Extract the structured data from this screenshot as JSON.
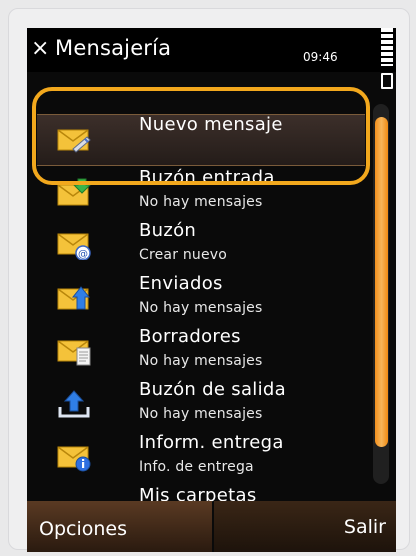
{
  "titlebar": {
    "close_glyph": "×",
    "title": "Mensajería",
    "clock": "09:46"
  },
  "items": [
    {
      "name": "Nuevo mensaje",
      "sub": "",
      "icon": "envelope-pen-icon"
    },
    {
      "name": "Buzón entrada",
      "sub": "No hay mensajes",
      "icon": "envelope-inbox-icon"
    },
    {
      "name": "Buzón",
      "sub": "Crear nuevo",
      "icon": "envelope-at-icon"
    },
    {
      "name": "Enviados",
      "sub": "No hay mensajes",
      "icon": "envelope-sent-icon"
    },
    {
      "name": "Borradores",
      "sub": "No hay mensajes",
      "icon": "envelope-draft-icon"
    },
    {
      "name": "Buzón de salida",
      "sub": "No hay mensajes",
      "icon": "outbox-upload-icon"
    },
    {
      "name": "Inform. entrega",
      "sub": "Info. de entrega",
      "icon": "envelope-info-icon"
    },
    {
      "name": "Mis carpetas",
      "sub": "",
      "icon": ""
    }
  ],
  "softkeys": {
    "left": "Opciones",
    "right": "Salir"
  },
  "colors": {
    "accent": "#f2a81d",
    "background": "#0a0a0a",
    "text": "#ffffff"
  }
}
